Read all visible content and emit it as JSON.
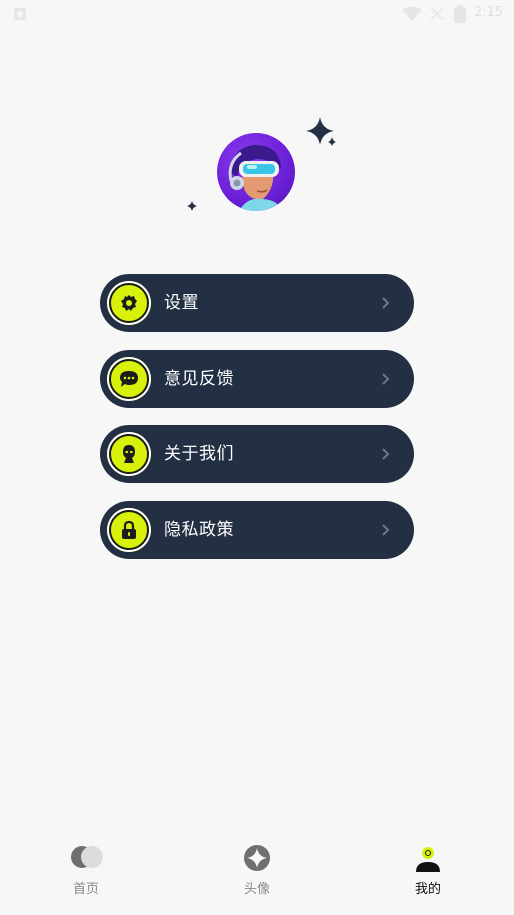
{
  "status_bar": {
    "time": "2:15",
    "icons": [
      "notification-icon",
      "wifi-icon",
      "signal-icon",
      "battery-icon"
    ]
  },
  "profile": {
    "avatar": "vr-headset-boy-avatar",
    "decorations": [
      "sparkle-icon",
      "sparkle-icon"
    ]
  },
  "menu": {
    "items": [
      {
        "label": "设置",
        "icon": "gear-icon"
      },
      {
        "label": "意见反馈",
        "icon": "chat-bubble-icon"
      },
      {
        "label": "关于我们",
        "icon": "user-icon"
      },
      {
        "label": "隐私政策",
        "icon": "lock-icon"
      }
    ],
    "chevron": "chevron-right-icon"
  },
  "tabbar": {
    "tabs": [
      {
        "label": "首页",
        "icon": "home-circles-icon",
        "active": false
      },
      {
        "label": "头像",
        "icon": "compass-icon",
        "active": false
      },
      {
        "label": "我的",
        "icon": "profile-icon",
        "active": true
      }
    ]
  },
  "colors": {
    "background": "#f7f7f7",
    "menu_bg": "#233044",
    "accent": "#d7f10a",
    "avatar_bg": "#6a1fd6",
    "tab_inactive": "#8a8a8a",
    "tab_active": "#111111"
  }
}
